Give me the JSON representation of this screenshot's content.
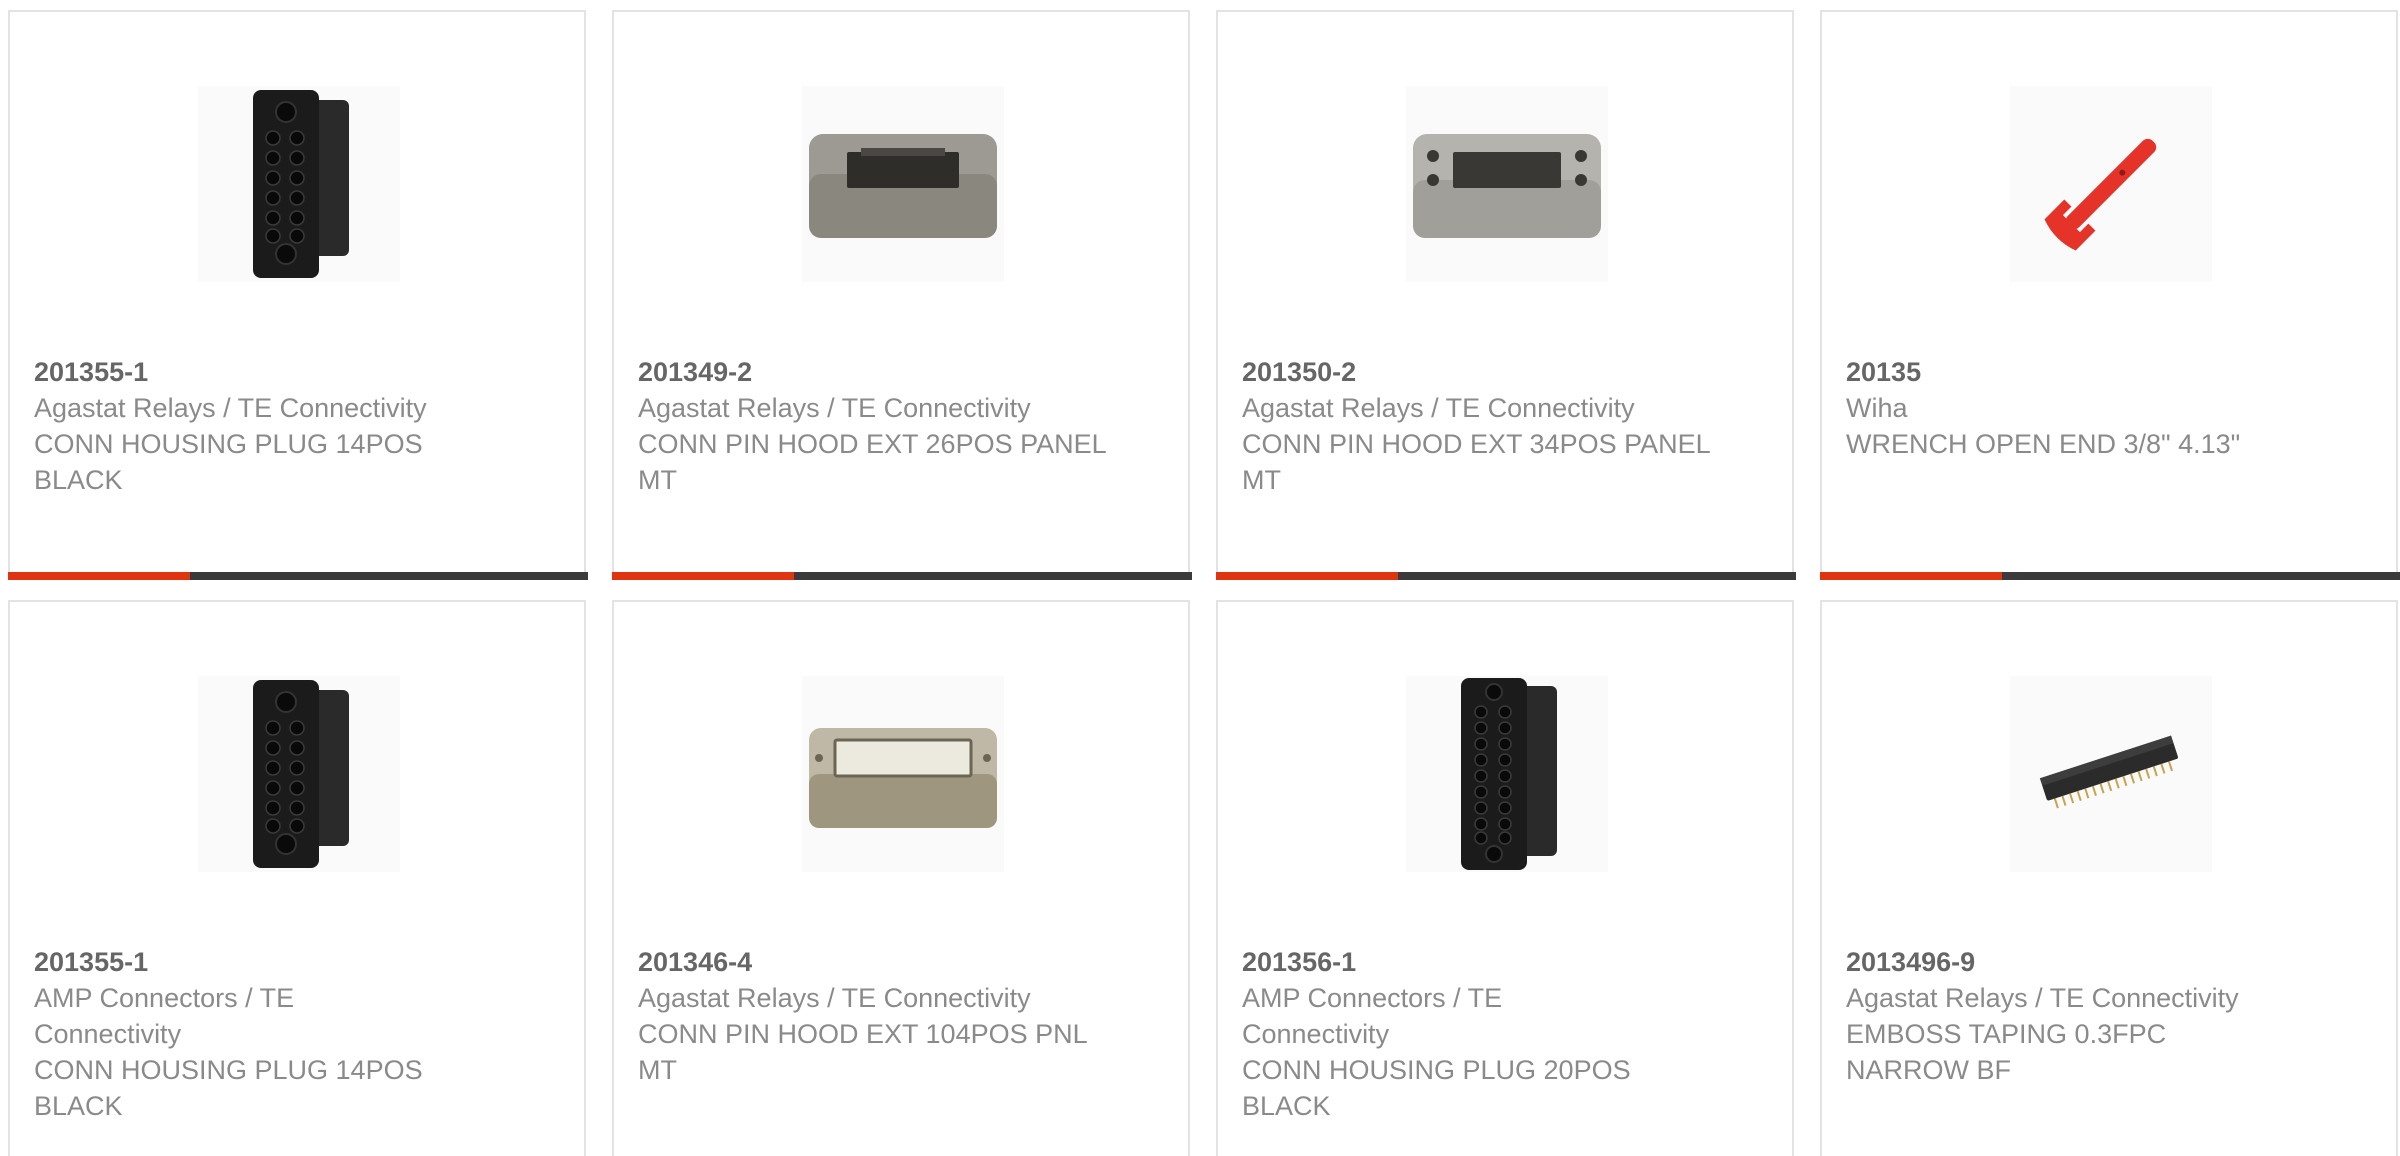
{
  "products": [
    {
      "part_number": "201355-1",
      "manufacturer": "Agastat Relays / TE Connectivity",
      "description": "CONN HOUSING PLUG 14POS BLACK",
      "image_icon": "black-connector-housing-icon"
    },
    {
      "part_number": "201349-2",
      "manufacturer": "Agastat Relays / TE Connectivity",
      "description": "CONN PIN HOOD EXT 26POS PANEL MT",
      "image_icon": "metal-pin-hood-icon"
    },
    {
      "part_number": "201350-2",
      "manufacturer": "Agastat Relays / TE Connectivity",
      "description": "CONN PIN HOOD EXT 34POS PANEL MT",
      "image_icon": "metal-pin-hood-icon"
    },
    {
      "part_number": "20135",
      "manufacturer": "Wiha",
      "description": "WRENCH OPEN END 3/8\" 4.13\"",
      "image_icon": "red-wrench-icon"
    },
    {
      "part_number": "201355-1",
      "manufacturer": "AMP Connectors / TE Connectivity",
      "description": "CONN HOUSING PLUG 14POS BLACK",
      "image_icon": "black-connector-housing-icon"
    },
    {
      "part_number": "201346-4",
      "manufacturer": "Agastat Relays / TE Connectivity",
      "description": "CONN PIN HOOD EXT 104POS PNL MT",
      "image_icon": "metal-pin-hood-icon"
    },
    {
      "part_number": "201356-1",
      "manufacturer": "AMP Connectors / TE Connectivity",
      "description": "CONN HOUSING PLUG 20POS BLACK",
      "image_icon": "black-connector-housing-icon"
    },
    {
      "part_number": "2013496-9",
      "manufacturer": "Agastat Relays / TE Connectivity",
      "description": "EMBOSS TAPING 0.3FPC NARROW BF",
      "image_icon": "fpc-connector-icon"
    }
  ],
  "colors": {
    "accent_red": "#e0330f",
    "accent_dark": "#3b3b3b",
    "border": "#e3e3e3",
    "text_muted": "#8a8a8a",
    "text_strong": "#666666"
  }
}
